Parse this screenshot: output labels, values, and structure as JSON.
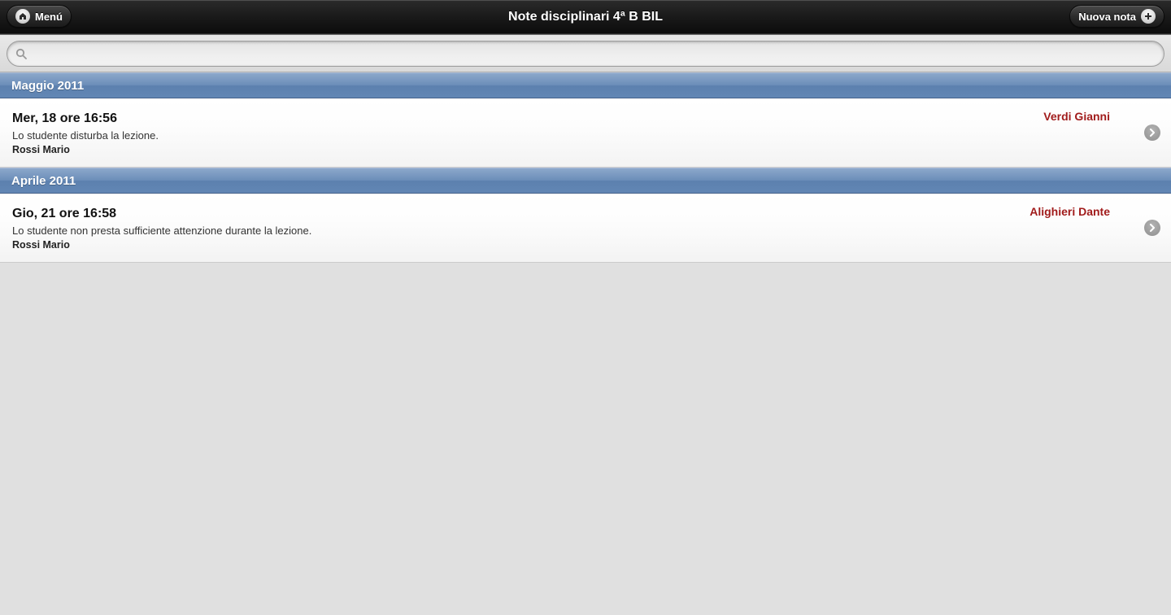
{
  "header": {
    "title": "Note disciplinari 4ª B BIL",
    "menu_label": "Menú",
    "new_label": "Nuova nota"
  },
  "search": {
    "value": "",
    "placeholder": ""
  },
  "sections": [
    {
      "title": "Maggio 2011",
      "items": [
        {
          "datetime": "Mer, 18 ore 16:56",
          "description": "Lo studente disturba la lezione.",
          "author": "Rossi Mario",
          "student": "Verdi Gianni"
        }
      ]
    },
    {
      "title": "Aprile 2011",
      "items": [
        {
          "datetime": "Gio, 21 ore 16:58",
          "description": "Lo studente non presta sufficiente attenzione durante la lezione.",
          "author": "Rossi Mario",
          "student": "Alighieri Dante"
        }
      ]
    }
  ]
}
